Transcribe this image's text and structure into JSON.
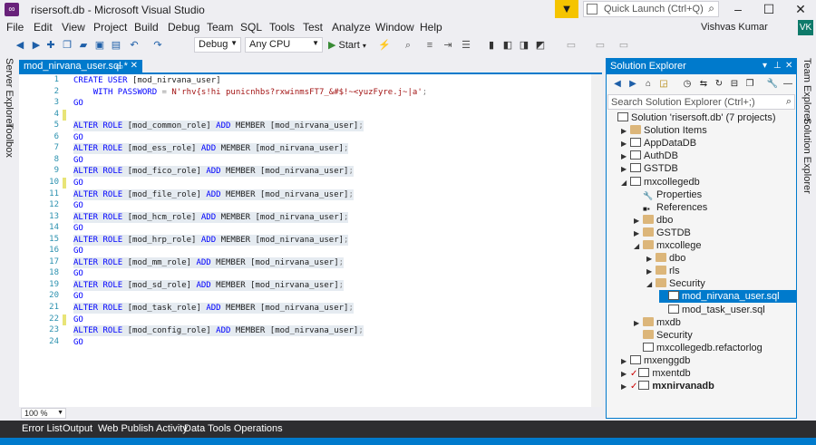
{
  "titlebar": {
    "title": "risersoft.db - Microsoft Visual Studio",
    "quick_launch_placeholder": "Quick Launch (Ctrl+Q)"
  },
  "menu": [
    "File",
    "Edit",
    "View",
    "Project",
    "Build",
    "Debug",
    "Team",
    "SQL",
    "Tools",
    "Test",
    "Analyze",
    "Window",
    "Help"
  ],
  "user": {
    "name": "Vishvas Kumar",
    "initials": "VK"
  },
  "toolbar": {
    "config": "Debug",
    "platform": "Any CPU",
    "start_label": "Start"
  },
  "editor": {
    "tab_title": "mod_nirvana_user.sql *",
    "zoom": "100 %",
    "lines": [
      {
        "n": "1",
        "tokens": [
          [
            "kw",
            "CREATE USER "
          ],
          [
            "",
            "[mod_nirvana_user]"
          ]
        ],
        "hl": false,
        "mark": false
      },
      {
        "n": "2",
        "tokens": [
          [
            "",
            "    "
          ],
          [
            "kw",
            "WITH PASSWORD "
          ],
          [
            "gray",
            "= "
          ],
          [
            "str",
            "N'rhv{s!hi punicnhbs?rxwinmsFT7_&#$!~<yuzFyre.j~|a'"
          ],
          [
            "gray",
            ";"
          ]
        ],
        "hl": false,
        "mark": false
      },
      {
        "n": "3",
        "tokens": [
          [
            "kw",
            "GO"
          ]
        ],
        "hl": false,
        "mark": false
      },
      {
        "n": "4",
        "tokens": [],
        "hl": false,
        "mark": true
      },
      {
        "n": "5",
        "tokens": [
          [
            "kw",
            "ALTER ROLE "
          ],
          [
            "",
            "[mod_common_role] "
          ],
          [
            "kw",
            "ADD "
          ],
          [
            "",
            "MEMBER [mod_nirvana_user]"
          ],
          [
            "gray",
            ";"
          ]
        ],
        "hl": true,
        "mark": false
      },
      {
        "n": "6",
        "tokens": [
          [
            "kw",
            "GO"
          ]
        ],
        "hl": false,
        "mark": false
      },
      {
        "n": "7",
        "tokens": [
          [
            "kw",
            "ALTER ROLE "
          ],
          [
            "",
            "[mod_ess_role] "
          ],
          [
            "kw",
            "ADD "
          ],
          [
            "",
            "MEMBER [mod_nirvana_user]"
          ],
          [
            "gray",
            ";"
          ]
        ],
        "hl": true,
        "mark": false
      },
      {
        "n": "8",
        "tokens": [
          [
            "kw",
            "GO"
          ]
        ],
        "hl": false,
        "mark": false
      },
      {
        "n": "9",
        "tokens": [
          [
            "kw",
            "ALTER ROLE "
          ],
          [
            "",
            "[mod_fico_role] "
          ],
          [
            "kw",
            "ADD "
          ],
          [
            "",
            "MEMBER [mod_nirvana_user]"
          ],
          [
            "gray",
            ";"
          ]
        ],
        "hl": true,
        "mark": false
      },
      {
        "n": "10",
        "tokens": [
          [
            "kw",
            "GO"
          ]
        ],
        "hl": false,
        "mark": true
      },
      {
        "n": "11",
        "tokens": [
          [
            "kw",
            "ALTER ROLE "
          ],
          [
            "",
            "[mod_file_role] "
          ],
          [
            "kw",
            "ADD "
          ],
          [
            "",
            "MEMBER [mod_nirvana_user]"
          ],
          [
            "gray",
            ";"
          ]
        ],
        "hl": true,
        "mark": false
      },
      {
        "n": "12",
        "tokens": [
          [
            "kw",
            "GO"
          ]
        ],
        "hl": false,
        "mark": false
      },
      {
        "n": "13",
        "tokens": [
          [
            "kw",
            "ALTER ROLE "
          ],
          [
            "",
            "[mod_hcm_role] "
          ],
          [
            "kw",
            "ADD "
          ],
          [
            "",
            "MEMBER [mod_nirvana_user]"
          ],
          [
            "gray",
            ";"
          ]
        ],
        "hl": true,
        "mark": false
      },
      {
        "n": "14",
        "tokens": [
          [
            "kw",
            "GO"
          ]
        ],
        "hl": false,
        "mark": false
      },
      {
        "n": "15",
        "tokens": [
          [
            "kw",
            "ALTER ROLE "
          ],
          [
            "",
            "[mod_hrp_role] "
          ],
          [
            "kw",
            "ADD "
          ],
          [
            "",
            "MEMBER [mod_nirvana_user]"
          ],
          [
            "gray",
            ";"
          ]
        ],
        "hl": true,
        "mark": false
      },
      {
        "n": "16",
        "tokens": [
          [
            "kw",
            "GO"
          ]
        ],
        "hl": false,
        "mark": false
      },
      {
        "n": "17",
        "tokens": [
          [
            "kw",
            "ALTER ROLE "
          ],
          [
            "",
            "[mod_mm_role] "
          ],
          [
            "kw",
            "ADD "
          ],
          [
            "",
            "MEMBER [mod_nirvana_user]"
          ],
          [
            "gray",
            ";"
          ]
        ],
        "hl": true,
        "mark": false
      },
      {
        "n": "18",
        "tokens": [
          [
            "kw",
            "GO"
          ]
        ],
        "hl": false,
        "mark": false
      },
      {
        "n": "19",
        "tokens": [
          [
            "kw",
            "ALTER ROLE "
          ],
          [
            "",
            "[mod_sd_role] "
          ],
          [
            "kw",
            "ADD "
          ],
          [
            "",
            "MEMBER [mod_nirvana_user]"
          ],
          [
            "gray",
            ";"
          ]
        ],
        "hl": true,
        "mark": false
      },
      {
        "n": "20",
        "tokens": [
          [
            "kw",
            "GO"
          ]
        ],
        "hl": false,
        "mark": false
      },
      {
        "n": "21",
        "tokens": [
          [
            "kw",
            "ALTER ROLE "
          ],
          [
            "",
            "[mod_task_role] "
          ],
          [
            "kw",
            "ADD "
          ],
          [
            "",
            "MEMBER [mod_nirvana_user]"
          ],
          [
            "gray",
            ";"
          ]
        ],
        "hl": true,
        "mark": false
      },
      {
        "n": "22",
        "tokens": [
          [
            "kw",
            "GO"
          ]
        ],
        "hl": false,
        "mark": true
      },
      {
        "n": "23",
        "tokens": [
          [
            "kw",
            "ALTER ROLE "
          ],
          [
            "",
            "[mod_config_role] "
          ],
          [
            "kw",
            "ADD "
          ],
          [
            "",
            "MEMBER [mod_nirvana_user]"
          ],
          [
            "gray",
            ";"
          ]
        ],
        "hl": true,
        "mark": false
      },
      {
        "n": "24",
        "tokens": [
          [
            "kw",
            "GO"
          ]
        ],
        "hl": false,
        "mark": false
      }
    ]
  },
  "side_rails": {
    "left": [
      "Server Explorer",
      "Toolbox"
    ],
    "right": [
      "Team Explorer",
      "Solution Explorer"
    ]
  },
  "solution_explorer": {
    "title": "Solution Explorer",
    "search_placeholder": "Search Solution Explorer (Ctrl+;)",
    "tree": [
      {
        "label": "Solution 'risersoft.db' (7 projects)",
        "depth": 0,
        "chev": "",
        "icon": "proj",
        "check": false,
        "sel": false,
        "bold": false
      },
      {
        "label": "Solution Items",
        "depth": 1,
        "chev": "▶",
        "icon": "folder",
        "check": false,
        "sel": false,
        "bold": false
      },
      {
        "label": "AppDataDB",
        "depth": 1,
        "chev": "▶",
        "icon": "proj",
        "check": false,
        "sel": false,
        "bold": false
      },
      {
        "label": "AuthDB",
        "depth": 1,
        "chev": "▶",
        "icon": "proj",
        "check": false,
        "sel": false,
        "bold": false
      },
      {
        "label": "GSTDB",
        "depth": 1,
        "chev": "▶",
        "icon": "proj",
        "check": false,
        "sel": false,
        "bold": false
      },
      {
        "label": "mxcollegedb",
        "depth": 1,
        "chev": "◢",
        "icon": "proj",
        "check": false,
        "sel": false,
        "bold": false
      },
      {
        "label": "Properties",
        "depth": 2,
        "chev": "",
        "icon": "wrench",
        "check": false,
        "sel": false,
        "bold": false
      },
      {
        "label": "References",
        "depth": 2,
        "chev": "",
        "icon": "refs",
        "check": false,
        "sel": false,
        "bold": false
      },
      {
        "label": "dbo",
        "depth": 2,
        "chev": "▶",
        "icon": "folder",
        "check": false,
        "sel": false,
        "bold": false
      },
      {
        "label": "GSTDB",
        "depth": 2,
        "chev": "▶",
        "icon": "folder",
        "check": false,
        "sel": false,
        "bold": false
      },
      {
        "label": "mxcollege",
        "depth": 2,
        "chev": "◢",
        "icon": "folder",
        "check": false,
        "sel": false,
        "bold": false
      },
      {
        "label": "dbo",
        "depth": 3,
        "chev": "▶",
        "icon": "folder",
        "check": false,
        "sel": false,
        "bold": false
      },
      {
        "label": "rls",
        "depth": 3,
        "chev": "▶",
        "icon": "folder",
        "check": false,
        "sel": false,
        "bold": false
      },
      {
        "label": "Security",
        "depth": 3,
        "chev": "◢",
        "icon": "folder",
        "check": false,
        "sel": false,
        "bold": false
      },
      {
        "label": "mod_nirvana_user.sql",
        "depth": 4,
        "chev": "",
        "icon": "sqlf",
        "check": false,
        "sel": true,
        "bold": false
      },
      {
        "label": "mod_task_user.sql",
        "depth": 4,
        "chev": "",
        "icon": "sqlf",
        "check": false,
        "sel": false,
        "bold": false
      },
      {
        "label": "mxdb",
        "depth": 2,
        "chev": "▶",
        "icon": "folder",
        "check": false,
        "sel": false,
        "bold": false
      },
      {
        "label": "Security",
        "depth": 2,
        "chev": "",
        "icon": "folder",
        "check": false,
        "sel": false,
        "bold": false
      },
      {
        "label": "mxcollegedb.refactorlog",
        "depth": 2,
        "chev": "",
        "icon": "sqlf",
        "check": false,
        "sel": false,
        "bold": false
      },
      {
        "label": "mxenggdb",
        "depth": 1,
        "chev": "▶",
        "icon": "proj",
        "check": false,
        "sel": false,
        "bold": false
      },
      {
        "label": "mxentdb",
        "depth": 1,
        "chev": "▶",
        "icon": "proj",
        "check": true,
        "sel": false,
        "bold": false
      },
      {
        "label": "mxnirvanadb",
        "depth": 1,
        "chev": "▶",
        "icon": "proj",
        "check": true,
        "sel": false,
        "bold": true
      }
    ]
  },
  "bottom_tabs": [
    "Error List",
    "Output",
    "Web Publish Activity",
    "Data Tools Operations"
  ]
}
